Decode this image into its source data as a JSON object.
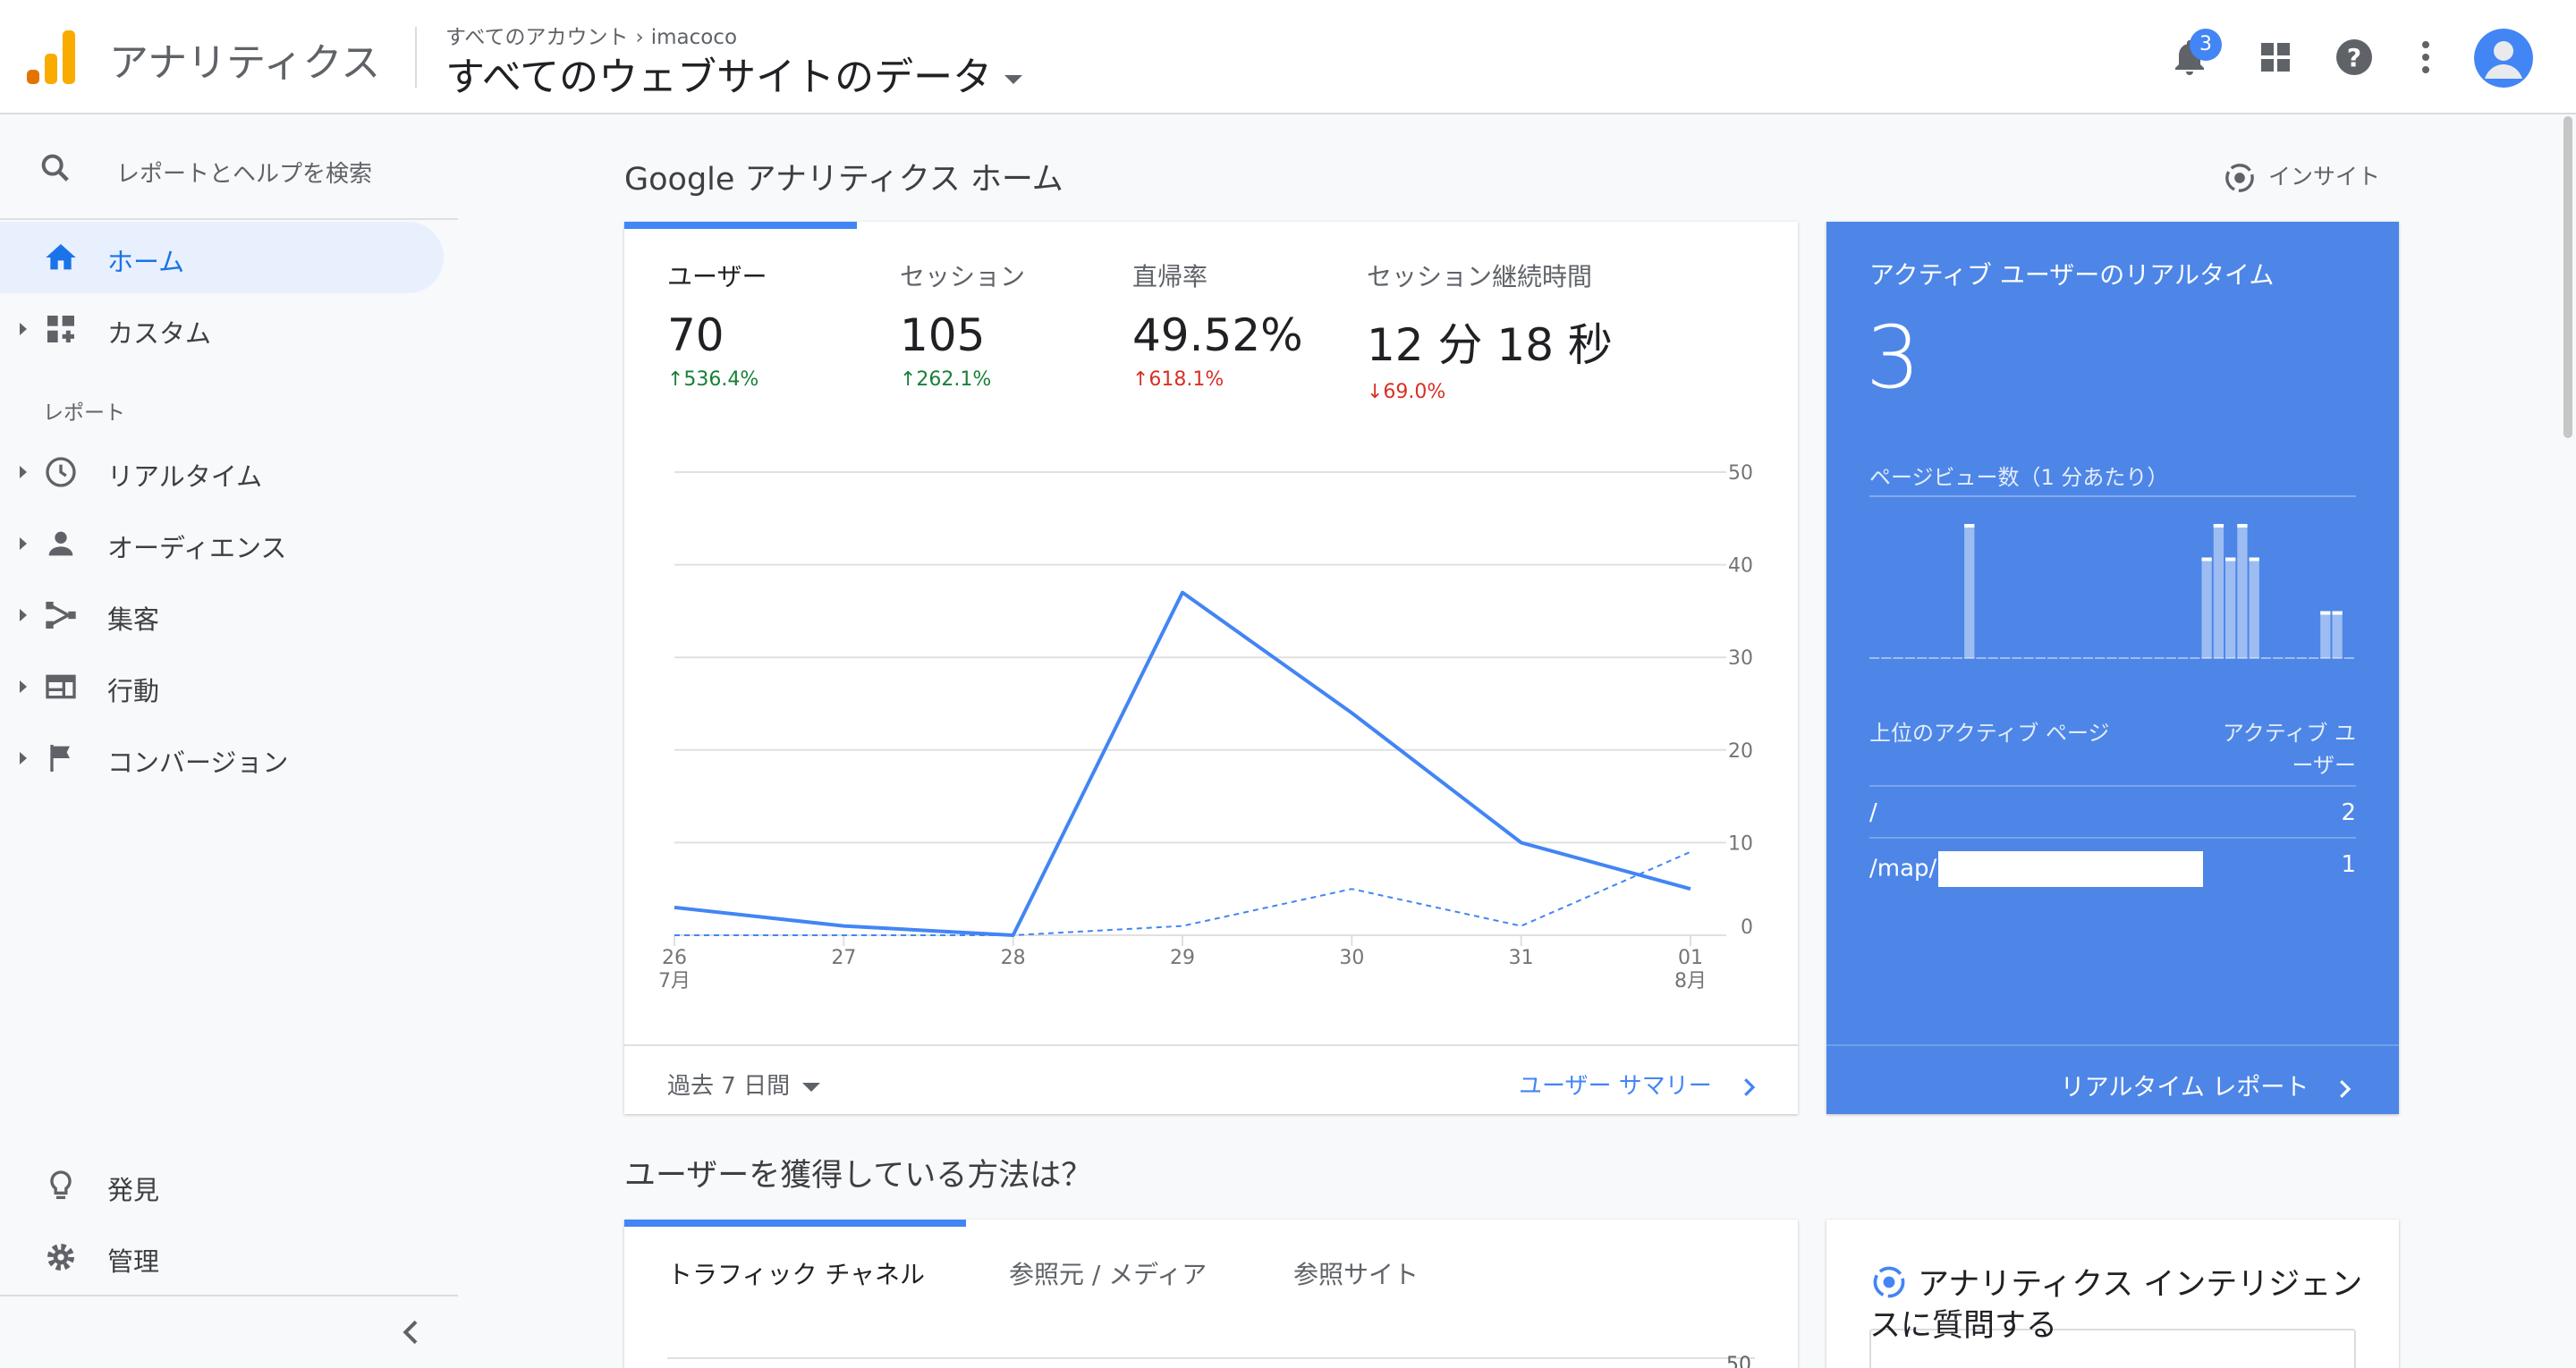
{
  "header": {
    "app_title": "アナリティクス",
    "breadcrumb": {
      "root": "すべてのアカウント",
      "account": "imacoco"
    },
    "view_title": "すべてのウェブサイトのデータ",
    "notification_count": "3",
    "logo_colors": [
      "#f9ab00",
      "#e37400"
    ]
  },
  "sidebar": {
    "search_placeholder": "レポートとヘルプを検索",
    "home": "ホーム",
    "custom": "カスタム",
    "reports_label": "レポート",
    "realtime": "リアルタイム",
    "audience": "オーディエンス",
    "acquisition": "集客",
    "behavior": "行動",
    "conversions": "コンバージョン",
    "discover": "発見",
    "admin": "管理"
  },
  "main": {
    "heading": "Google アナリティクス ホーム",
    "insights": "インサイト",
    "metrics": [
      {
        "label": "ユーザー",
        "value": "70",
        "change": "↑536.4%",
        "trend": "good"
      },
      {
        "label": "セッション",
        "value": "105",
        "change": "↑262.1%",
        "trend": "good"
      },
      {
        "label": "直帰率",
        "value": "49.52%",
        "change": "↑618.1%",
        "trend": "bad"
      },
      {
        "label": "セッション継続時間",
        "value": "12 分 18 秒",
        "change": "↓69.0%",
        "trend": "bad"
      }
    ],
    "period": "過去 7 日間",
    "summary_link": "ユーザー サマリー"
  },
  "chart_data": {
    "type": "line",
    "x": [
      "26",
      "27",
      "28",
      "29",
      "30",
      "31",
      "01"
    ],
    "x_sublabels": {
      "0": "7月",
      "6": "8月"
    },
    "ylim": [
      0,
      50
    ],
    "yticks": [
      0,
      10,
      20,
      30,
      40,
      50
    ],
    "grid": true,
    "series": [
      {
        "values": [
          3,
          1,
          0,
          37,
          24,
          10,
          5
        ],
        "style": "solid"
      },
      {
        "values": [
          0,
          0,
          0,
          1,
          5,
          1,
          9
        ],
        "style": "dashed"
      }
    ],
    "color": "#4285f4"
  },
  "realtime": {
    "title": "アクティブ ユーザーのリアルタイム",
    "count": "3",
    "pageviews_label": "ページビュー数（1 分あたり）",
    "pageviews_per_minute": [
      0,
      0,
      0,
      0,
      0,
      0,
      0,
      0,
      2,
      0,
      0,
      0,
      0,
      0,
      0,
      0,
      0,
      0,
      0,
      0,
      0,
      0,
      0,
      0,
      0,
      0,
      0,
      0,
      1.5,
      2,
      1.5,
      2,
      1.5,
      0,
      0,
      0,
      0,
      0,
      0.7,
      0.7,
      0
    ],
    "col_page": "上位のアクティブ ページ",
    "col_users": "アクティブ ユーザー",
    "rows": [
      {
        "page": "/",
        "users": "2"
      },
      {
        "page": "/map/",
        "users": "1"
      }
    ],
    "report_link": "リアルタイム レポート"
  },
  "acquisition_section": {
    "heading": "ユーザーを獲得している方法は？",
    "tabs": [
      "トラフィック チャネル",
      "参照元 / メディア",
      "参照サイト"
    ],
    "partial_tick": "50"
  },
  "intelligence": {
    "title": "アナリティクス インテリジェンスに質問する"
  },
  "colors": {
    "accent": "#4285f4",
    "realtime_bg": "#4d86e7",
    "positive": "#188038",
    "negative": "#d93025"
  }
}
